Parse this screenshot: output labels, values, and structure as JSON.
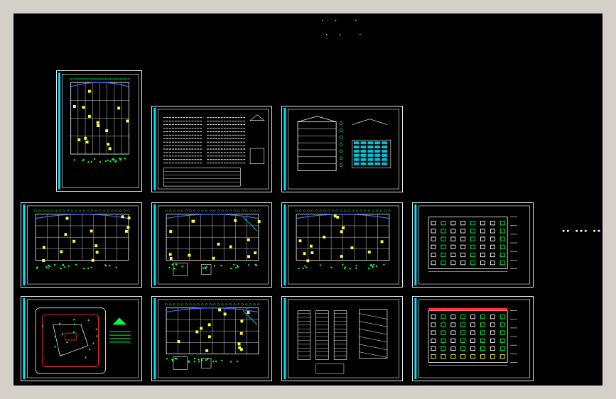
{
  "canvas": {
    "background": "#000000",
    "frame": "#d4d0c8",
    "line_colors": {
      "white": "#ffffff",
      "cyan": "#00e5ff",
      "green": "#00ff40",
      "yellow": "#ffff33",
      "red": "#ff3030",
      "blue": "#3a6cff",
      "magenta": "#ff33ff"
    }
  },
  "header_mark": "· ·  ·",
  "side_mark": "▪▪ ▪▪▪ ▪▪",
  "sheets": [
    {
      "id": "floor-plan-portrait",
      "kind": "plan-portrait"
    },
    {
      "id": "design-notes",
      "kind": "notes"
    },
    {
      "id": "section-and-tables",
      "kind": "section"
    },
    {
      "id": "floor-plan-1",
      "kind": "plan"
    },
    {
      "id": "floor-plan-2",
      "kind": "plan-details"
    },
    {
      "id": "floor-plan-3",
      "kind": "plan"
    },
    {
      "id": "elevation-front",
      "kind": "elevation"
    },
    {
      "id": "site-plan",
      "kind": "site"
    },
    {
      "id": "roof-and-details",
      "kind": "plan-details"
    },
    {
      "id": "stair-details",
      "kind": "stairs"
    },
    {
      "id": "elevation-rear",
      "kind": "elevation2"
    }
  ]
}
